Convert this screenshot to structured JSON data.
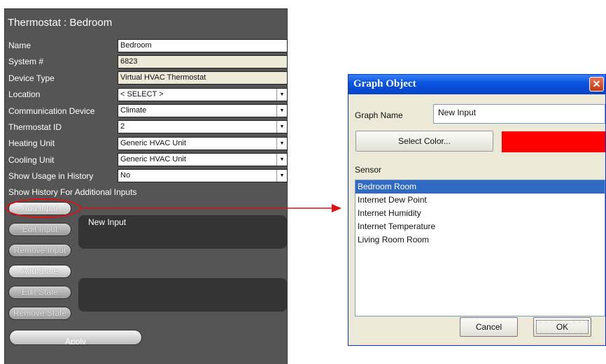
{
  "thermostat": {
    "title": "Thermostat : Bedroom",
    "fields": [
      {
        "label": "Name",
        "value": "Bedroom"
      },
      {
        "label": "System #",
        "value": "6823"
      },
      {
        "label": "Device Type",
        "value": "Virtual HVAC Thermostat"
      },
      {
        "label": "Location",
        "value": "< SELECT >"
      },
      {
        "label": "Communication Device",
        "value": "Climate"
      },
      {
        "label": "Thermostat ID",
        "value": "2"
      },
      {
        "label": "Heating Unit",
        "value": "Generic HVAC Unit"
      },
      {
        "label": "Cooling Unit",
        "value": "Generic HVAC Unit"
      },
      {
        "label": "Show Usage in History",
        "value": "No"
      }
    ],
    "additional_inputs_label": "Show History For Additional Inputs",
    "buttons": {
      "add_input": "Add Input",
      "edit_input": "Edit Input",
      "remove_input": "Remove Input",
      "add_state": "Add State",
      "edit_state": "Edit State",
      "remove_state": "Remove State",
      "apply": "Apply"
    },
    "inputs_list": [
      "New Input"
    ]
  },
  "dialog": {
    "title": "Graph Object",
    "close_glyph": "✕",
    "graph_name_label": "Graph Name",
    "graph_name_value": "New Input",
    "select_color_label": "Select Color...",
    "selected_color": "#ff0000",
    "sensor_label": "Sensor",
    "sensors": [
      "Bedroom Room",
      "Internet Dew Point",
      "Internet Humidity",
      "Internet Temperature",
      "Living Room Room"
    ],
    "selected_sensor": "Bedroom Room",
    "cancel_label": "Cancel",
    "ok_label": "OK"
  },
  "colors": {
    "panel_bg": "#555555",
    "highlight": "#e11010",
    "titlebar": "#0a56e2",
    "selection": "#316ac5"
  }
}
